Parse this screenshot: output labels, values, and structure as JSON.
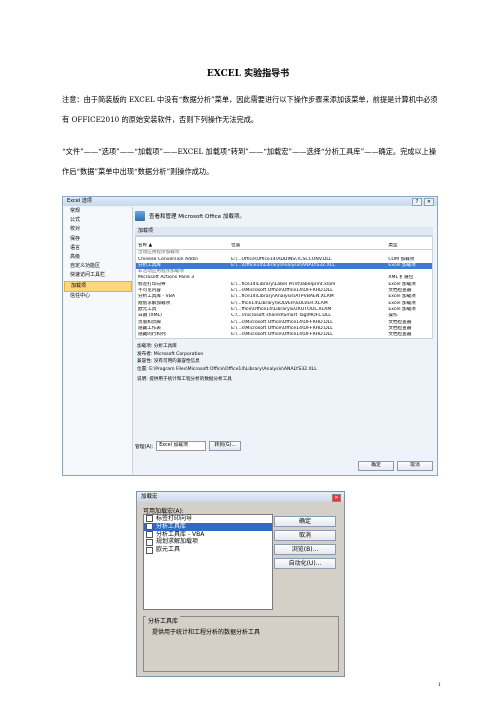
{
  "doc": {
    "title": "EXCEL 实验指导书",
    "note": "注意：由于简装版的 EXCEL 中没有“数据分析”菜单，因此需要进行以下操作步骤来添加该菜单，前提是计算机中必须有 OFFICE2010 的原始安装软件，否则下列操作无法完成。",
    "steps": "“文件”——“选项”——“加载项”——EXCEL 加载项“转到”——“加载宏”——选择“分析工具库”——确定。完成以上操作后“数据”菜单中出现“数据分析”则操作成功。",
    "page_number": "1"
  },
  "options_dialog": {
    "title": "Excel 选项",
    "sidebar": [
      "常规",
      "公式",
      "校对",
      "保存",
      "语言",
      "高级",
      "自定义功能区",
      "快速访问工具栏",
      "加载项",
      "信任中心"
    ],
    "selected_index": 8,
    "header": "查看和管理 Microsoft Office 加载项。",
    "section": "加载项",
    "columns": [
      "名称 ▲",
      "位置",
      "类型"
    ],
    "groups": [
      {
        "label": "活动应用程序加载项",
        "rows": [
          [
            "Chinese Conversion Addin",
            "E:\\...Office\\Office14\\ADDINS\\TCSCCONV.DLL",
            "COM 加载项"
          ],
          [
            "分析工具库",
            "E:\\...\\Office14\\Library\\Analysis\\ANALYS32.XLL",
            "Excel 加载项"
          ]
        ]
      },
      {
        "label": "非活动应用程序加载项",
        "rows": [
          [
            "Microsoft Actions Pane 3",
            "",
            "XML 扩展包"
          ],
          [
            "标签打印向导",
            "E:\\...fice14\\Library\\Label Print\\labelprint.xlam",
            "Excel 加载项"
          ],
          [
            "不可见内容",
            "E:\\...s\\Microsoft Office\\Office14\\OFFRHD.DLL",
            "文档检查器"
          ],
          [
            "分析工具库 - VBA",
            "E:\\...fice14\\Library\\Analysis\\ATPVBAEN.XLAM",
            "Excel 加载项"
          ],
          [
            "规划求解加载项",
            "E:\\...ffice14\\Library\\SOLVER\\SOLVER.XLAM",
            "Excel 加载项"
          ],
          [
            "欧元工具",
            "E:\\...ffice\\Office14\\Library\\EUROTOOL.XLAM",
            "Excel 加载项"
          ],
          [
            "日期 (XML)",
            "C:\\...\\microsoft shared\\Smart Tag\\MOFL.DLL",
            "操作"
          ],
          [
            "页眉和页脚",
            "E:\\...s\\Microsoft Office\\Office14\\OFFRHD.DLL",
            "文档检查器"
          ],
          [
            "隐藏工作表",
            "E:\\...s\\Microsoft Office\\Office14\\OFFRHD.DLL",
            "文档检查器"
          ],
          [
            "隐藏的行和列",
            "E:\\...s\\Microsoft Office\\Office14\\OFFRHD.DLL",
            "文档检查器"
          ]
        ]
      }
    ],
    "selected_row": "分析工具库",
    "info": {
      "addin": "加载项:  分析工具库",
      "publisher": "发布者:  Microsoft Corporation",
      "compat": "兼容性:  没有可用的兼容性信息",
      "location": "位置:    E:\\Program Files\\Microsoft Office\\Office14\\Library\\Analysis\\ANALYS32.XLL",
      "desc": "说明:    提供用于统计和工程分析的数据分析工具"
    },
    "manage_label": "管理(A):",
    "manage_value": "Excel 加载项",
    "go_button": "转到(G)...",
    "ok": "确定",
    "cancel": "取消"
  },
  "addins_dialog": {
    "title": "加载宏",
    "list_label": "可用加载宏(A):",
    "items": [
      {
        "label": "标签打印向导",
        "checked": false
      },
      {
        "label": "分析工具库",
        "checked": true
      },
      {
        "label": "分析工具库 - VBA",
        "checked": false
      },
      {
        "label": "规划求解加载项",
        "checked": false
      },
      {
        "label": "欧元工具",
        "checked": false
      }
    ],
    "buttons": [
      "确定",
      "取消",
      "浏览(B)...",
      "自动化(U)..."
    ],
    "group_title": "分析工具库",
    "group_desc": "提供用于统计和工程分析的数据分析工具"
  }
}
